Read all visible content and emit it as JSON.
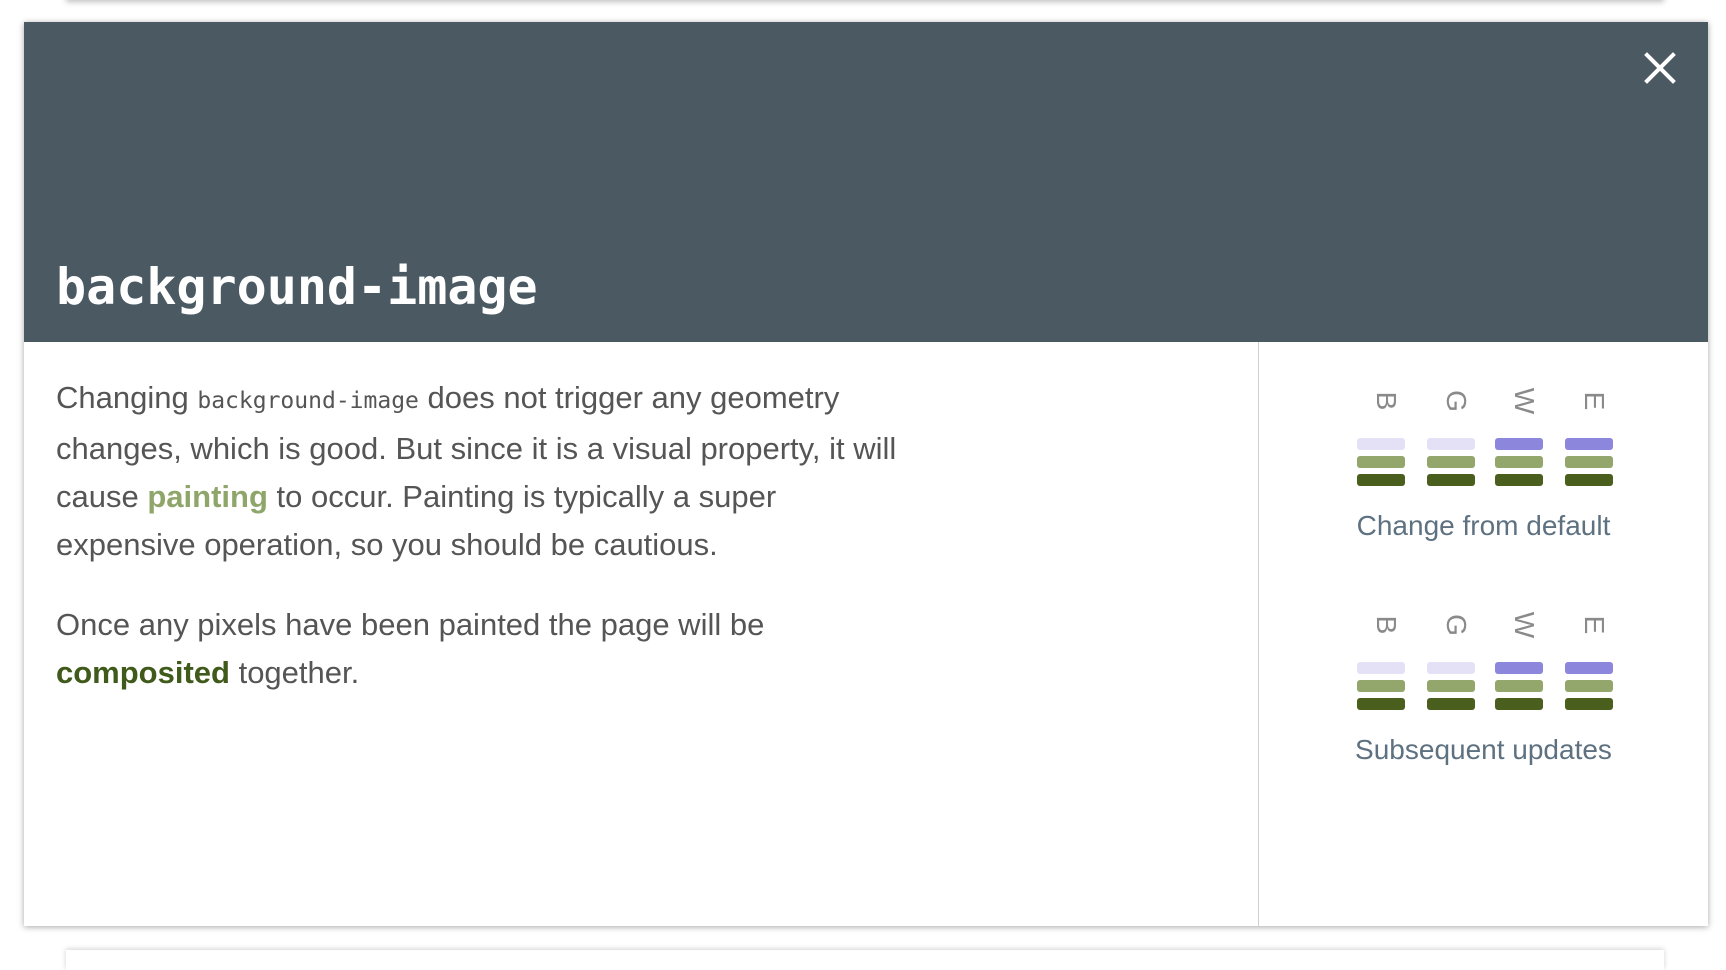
{
  "modal": {
    "title": "background-image",
    "close_icon": "close-icon",
    "paragraph1": {
      "part1": "Changing ",
      "code": "background-image",
      "part2": " does not trigger any geometry changes, which is good. But since it is a visual property, it will cause ",
      "link": "painting",
      "part3": " to occur. Painting is typically a super expensive operation, so you should be cautious."
    },
    "paragraph2": {
      "part1": "Once any pixels have been painted the page will be ",
      "link": "composited",
      "part2": " together."
    }
  },
  "legend_letters": [
    "B",
    "G",
    "W",
    "E"
  ],
  "metrics": [
    {
      "label": "Change from default",
      "columns": [
        {
          "letter": "B",
          "layout": false,
          "paint": true,
          "composite": true
        },
        {
          "letter": "G",
          "layout": false,
          "paint": true,
          "composite": true
        },
        {
          "letter": "W",
          "layout": true,
          "paint": true,
          "composite": true
        },
        {
          "letter": "E",
          "layout": true,
          "paint": true,
          "composite": true
        }
      ]
    },
    {
      "label": "Subsequent updates",
      "columns": [
        {
          "letter": "B",
          "layout": false,
          "paint": true,
          "composite": true
        },
        {
          "letter": "G",
          "layout": false,
          "paint": true,
          "composite": true
        },
        {
          "letter": "W",
          "layout": true,
          "paint": true,
          "composite": true
        },
        {
          "letter": "E",
          "layout": true,
          "paint": true,
          "composite": true
        }
      ]
    }
  ],
  "colors": {
    "header_bg": "#4a5962",
    "layout_on": "#8c86dd",
    "layout_off": "#e4e1f6",
    "paint": "#93a66b",
    "composite": "#4a5f1e",
    "painting_link": "#8fa66b",
    "composited_link": "#3f5a1a",
    "metric_label": "#5e7180"
  }
}
